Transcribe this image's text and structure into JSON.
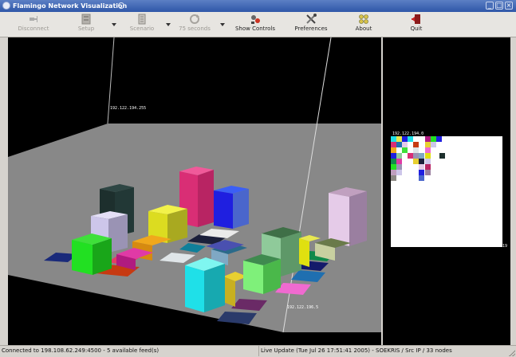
{
  "window": {
    "title": "Flamingo Network Visualization"
  },
  "toolbar": {
    "items": [
      {
        "label": "Disconnect",
        "icon": "disconnect-plug-icon",
        "enabled": false
      },
      {
        "label": "Setup",
        "icon": "setup-server-icon",
        "enabled": false
      },
      {
        "label": "Scenario",
        "icon": "scenario-icon",
        "enabled": false
      },
      {
        "label": "75 seconds",
        "icon": "refresh-interval-icon",
        "enabled": false
      },
      {
        "label": "Show Controls",
        "icon": "show-controls-icon",
        "enabled": true
      },
      {
        "label": "Preferences",
        "icon": "preferences-tools-icon",
        "enabled": true
      },
      {
        "label": "About",
        "icon": "about-flamingo-icon",
        "enabled": true
      },
      {
        "label": "Quit",
        "icon": "quit-door-icon",
        "enabled": true
      }
    ]
  },
  "scene": {
    "label_top": "192.122.194.255",
    "label_bottom": "192.122.196.5",
    "label_side": "192.122.194.0",
    "label_side_edge": "19"
  },
  "status": {
    "connection": "Connected to 198.108.62.249:4500 - 5 available feed(s)",
    "update": "Live Update (Tue Jul 26 17:51:41 2005) - SOEKRIS / Src IP / 33 nodes"
  }
}
